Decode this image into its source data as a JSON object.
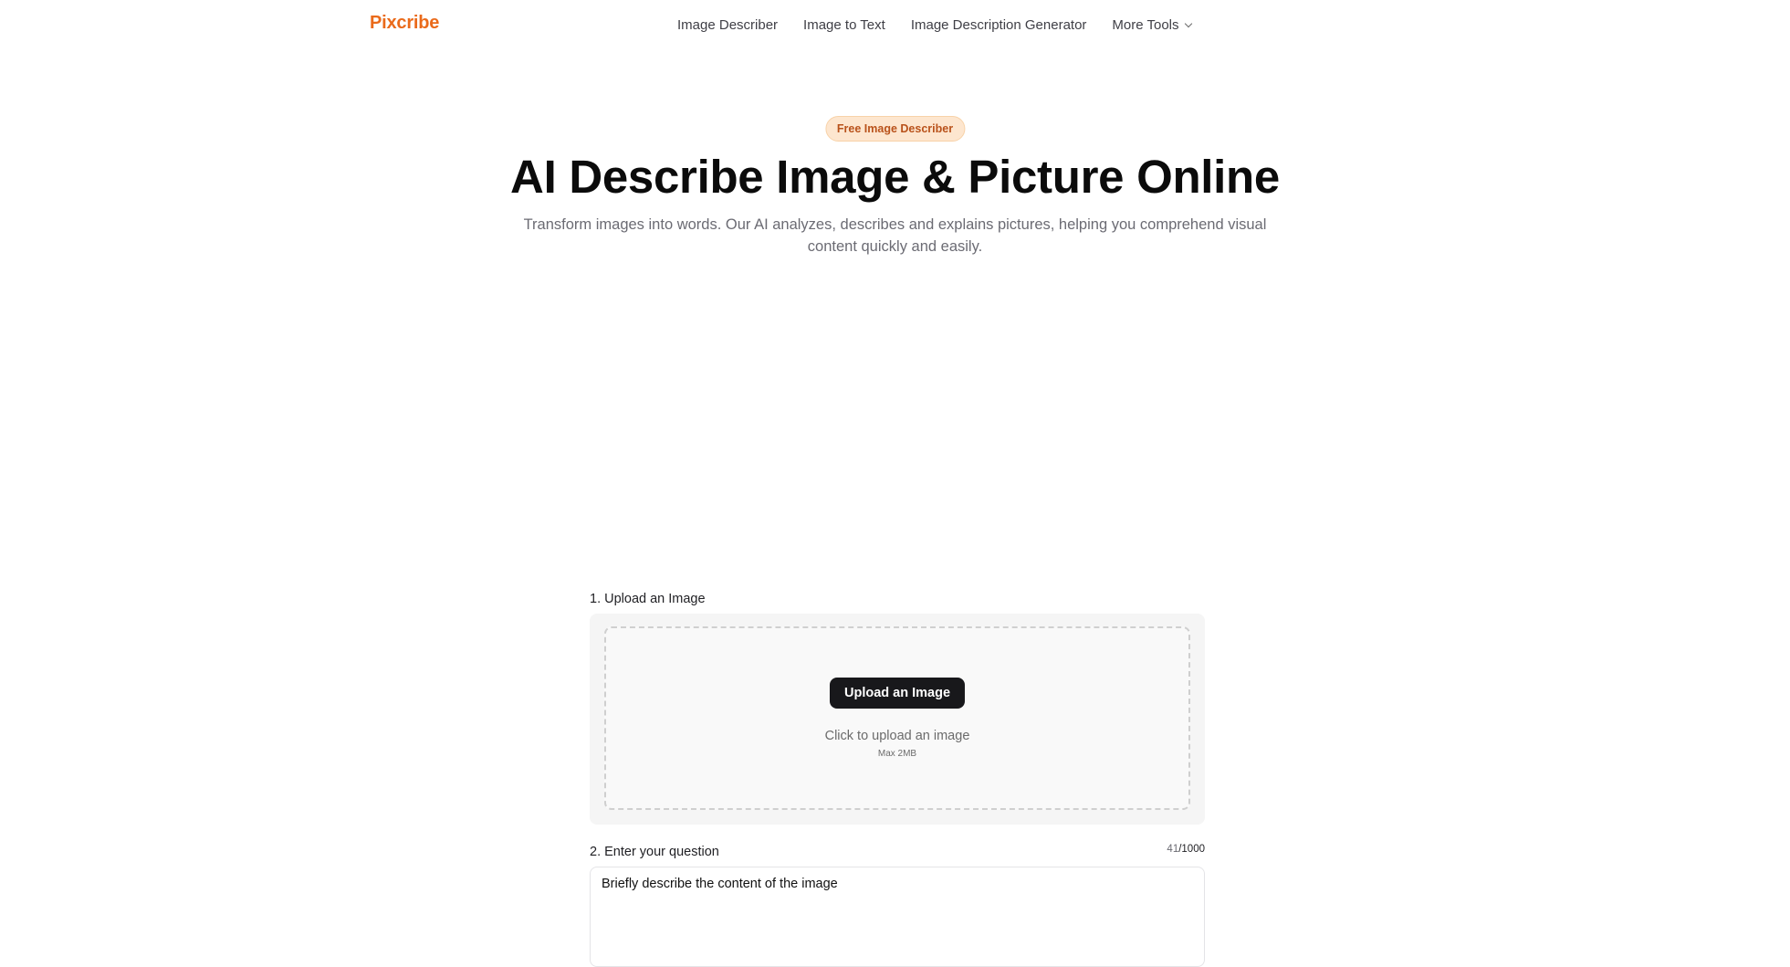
{
  "header": {
    "logo": "Pixcribe",
    "nav": [
      {
        "label": "Image Describer"
      },
      {
        "label": "Image to Text"
      },
      {
        "label": "Image Description Generator"
      },
      {
        "label": "More Tools"
      }
    ]
  },
  "hero": {
    "badge": "Free Image Describer",
    "title": "AI Describe Image & Picture Online",
    "subtitle": "Transform images into words. Our AI analyzes, describes and explains pictures, helping you comprehend visual content quickly and easily."
  },
  "tool": {
    "step1_label": "1. Upload an Image",
    "upload_button": "Upload an Image",
    "upload_hint": "Click to upload an image",
    "upload_max": "Max 2MB",
    "step2_label": "2. Enter your question",
    "char_count": "41",
    "char_limit": "/1000",
    "question_value": "Briefly describe the content of the image"
  },
  "colors": {
    "brand": "#ea6a1a",
    "badge_bg": "#fde6cf",
    "button_bg": "#18181b"
  },
  "icons": {
    "more_tools": "chevron-down-icon"
  }
}
